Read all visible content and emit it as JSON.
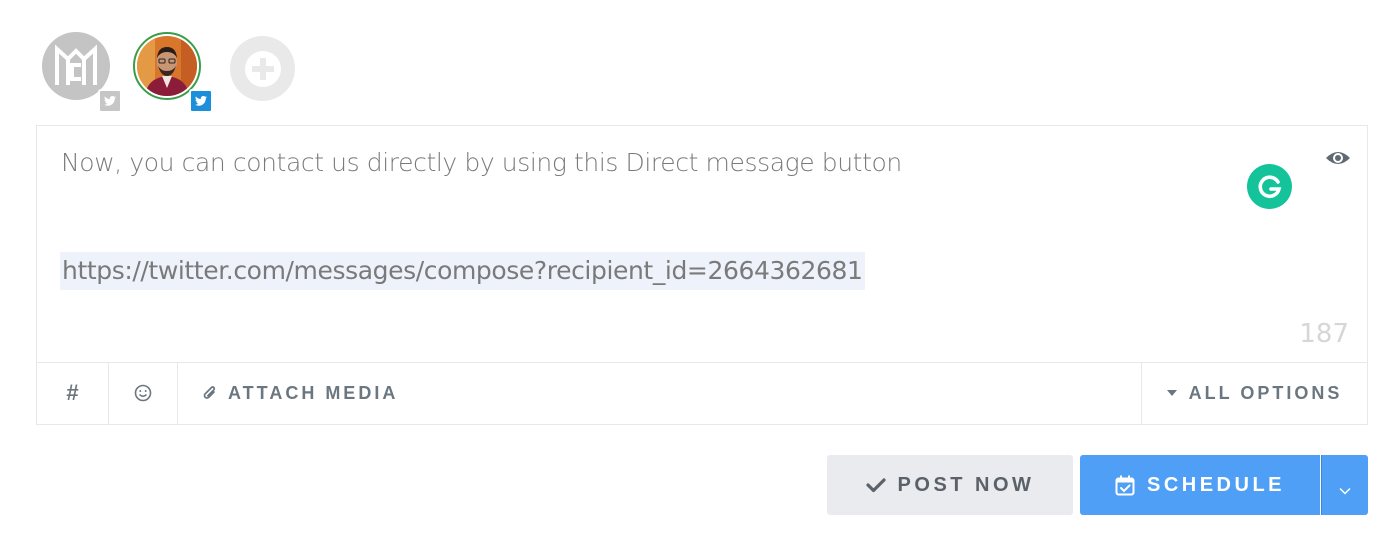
{
  "accounts": [
    {
      "icon": "mc-logo-avatar",
      "network": "twitter",
      "selected": false
    },
    {
      "icon": "profile-photo-avatar",
      "network": "twitter",
      "selected": true
    }
  ],
  "add_account_icon": "plus-icon",
  "editor": {
    "message": "Now, you can contact us directly by using this Direct message button",
    "link": "https://twitter.com/messages/compose?recipient_id=2664362681",
    "char_count": "187",
    "preview_icon": "eye-icon",
    "grammarly_icon": "grammarly-icon"
  },
  "toolbar": {
    "hashtag_label": "#",
    "attach_label": "ATTACH MEDIA",
    "options_label": "ALL OPTIONS"
  },
  "actions": {
    "post_now_label": "POST NOW",
    "schedule_label": "SCHEDULE"
  },
  "colors": {
    "primary": "#4e9ff5",
    "secondary_button": "#e9ebee",
    "twitter_blue": "#1c8fdb",
    "grammarly_green": "#15c39a",
    "link_highlight": "#eef3fb"
  }
}
